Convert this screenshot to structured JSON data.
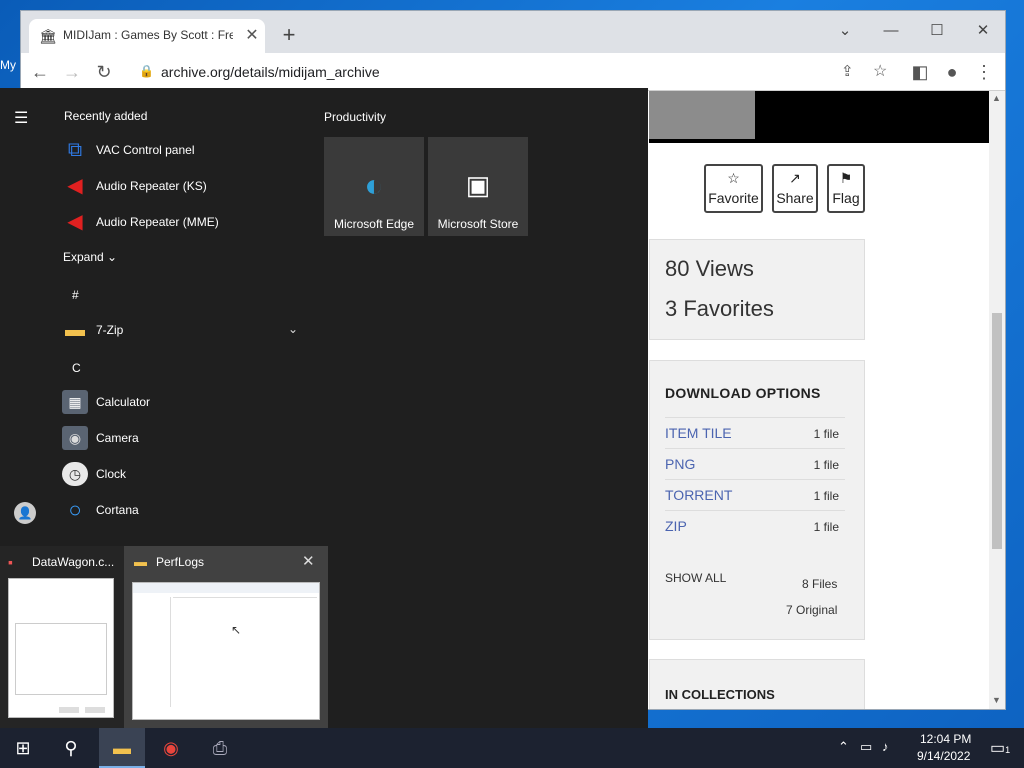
{
  "desktop": {
    "icon_label": "My"
  },
  "browser": {
    "tab_title": "MIDIJam : Games By Scott : Free",
    "url": "archive.org/details/midijam_archive",
    "actions": {
      "favorite": "Favorite",
      "share": "Share",
      "flag": "Flag"
    },
    "stats": {
      "views": "80 Views",
      "favorites": "3 Favorites"
    },
    "downloads": {
      "title": "DOWNLOAD OPTIONS",
      "rows": [
        {
          "type": "ITEM TILE",
          "count": "1 file"
        },
        {
          "type": "PNG",
          "count": "1 file"
        },
        {
          "type": "TORRENT",
          "count": "1 file"
        },
        {
          "type": "ZIP",
          "count": "1 file"
        }
      ],
      "show_all": "SHOW ALL",
      "files": "8 Files",
      "original": "7 Original"
    },
    "collections_title": "IN COLLECTIONS"
  },
  "start_menu": {
    "recently_added": "Recently added",
    "recent_apps": [
      {
        "label": "VAC Control panel",
        "icon": "vac-icon"
      },
      {
        "label": "Audio Repeater (KS)",
        "icon": "audio-repeater-icon"
      },
      {
        "label": "Audio Repeater (MME)",
        "icon": "audio-repeater-icon"
      }
    ],
    "expand": "Expand",
    "letter_hash": "#",
    "zip_label": "7-Zip",
    "letter_c": "C",
    "c_apps": [
      {
        "label": "Calculator",
        "icon": "calculator-icon"
      },
      {
        "label": "Camera",
        "icon": "camera-icon"
      },
      {
        "label": "Clock",
        "icon": "clock-icon"
      },
      {
        "label": "Cortana",
        "icon": "cortana-icon"
      }
    ],
    "productivity": "Productivity",
    "tiles": [
      {
        "label": "Microsoft Edge",
        "icon": "edge-icon"
      },
      {
        "label": "Microsoft Store",
        "icon": "store-icon"
      }
    ]
  },
  "thumbnails": {
    "first_title": "DataWagon.c...",
    "second_title": "PerfLogs"
  },
  "taskbar": {
    "time": "12:04 PM",
    "date": "9/14/2022",
    "notification_count": "1"
  }
}
